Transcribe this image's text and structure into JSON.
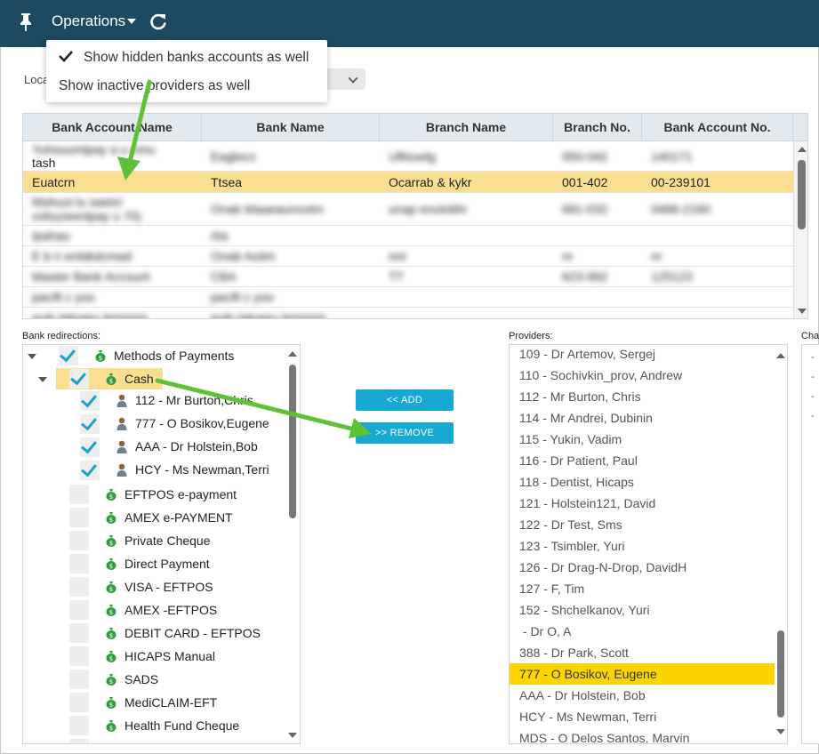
{
  "toolbar": {
    "menu_label": "Operations",
    "icons": {
      "pin": "pin-icon",
      "caret": "caret-down-icon",
      "refresh": "refresh-icon"
    }
  },
  "operations_menu": {
    "items": [
      {
        "label": "Show hidden banks accounts as well",
        "checked": true
      },
      {
        "label": "Show inactive providers as well",
        "checked": false
      }
    ]
  },
  "location": {
    "label": "Loca"
  },
  "bank_table": {
    "columns": [
      "Bank Account Name",
      "Bank Name",
      "Branch Name",
      "Branch No.",
      "Bank Account No."
    ],
    "rows": [
      {
        "cells": [
          "Yuhsuumlpay a u mnu",
          "Eagleco",
          "Ufkluwlg",
          "050-042",
          "140171"
        ],
        "line2": "tash",
        "blurred": true
      },
      {
        "cells": [
          "Euatcrn",
          "Ttsea",
          "Ocarrab & kykr",
          "001-402",
          "00-239101"
        ],
        "selected": true
      },
      {
        "cells": [
          "Mahuoi lu saein/",
          "Onab Maaeaunovtm",
          "unap enulvbhr",
          "681-032",
          "0466-2160"
        ],
        "line2": "vsfoureenlpay u 70)",
        "blurred": true
      },
      {
        "cells": [
          "Ipahao",
          "rtia",
          "",
          "",
          ""
        ],
        "blurred": true
      },
      {
        "cells": [
          "E b n enlakdcmad",
          "Onab Aoiim",
          "nnt",
          "nr",
          "nr"
        ],
        "blurred": true
      },
      {
        "cells": [
          "Master Bank Account",
          "CBA",
          "TT",
          "623-992",
          "125123"
        ],
        "blurred": true
      },
      {
        "cells": [
          "pacift c yoo",
          "pacift c yoo",
          "",
          "",
          ""
        ],
        "blurred": true
      },
      {
        "cells": [
          "euln latnaeu lennnnn",
          "euln latnaeu lennnnn",
          "",
          "",
          ""
        ],
        "blurred": true
      }
    ]
  },
  "bank_redirections": {
    "label": "Bank redirections:",
    "root": "Methods of Payments",
    "cash": "Cash",
    "cash_children": [
      "112 - Mr Burton,Chris",
      "777 - O Bosikov,Eugene",
      "AAA - Dr Holstein,Bob",
      "HCY - Ms Newman,Terri"
    ],
    "methods": [
      "EFTPOS e-payment",
      "AMEX e-PAYMENT",
      "Private Cheque",
      "Direct Payment",
      "VISA - EFTPOS",
      "AMEX -EFTPOS",
      "DEBIT CARD - EFTPOS",
      "HICAPS Manual",
      "SADS",
      "MediCLAIM-EFT",
      "Health Fund Cheque"
    ]
  },
  "buttons": {
    "add": "<< ADD",
    "remove": ">> REMOVE"
  },
  "providers": {
    "label": "Providers:",
    "items": [
      "109 - Dr Artemov, Sergej",
      "110 -  Sochivkin_prov, Andrew",
      "112 - Mr Burton, Chris",
      "114 - Mr Andrei, Dubinin",
      "115 -  Yukin, Vadim",
      "116 - Dr Patient, Paul",
      "118 -  Dentist, Hicaps",
      "121 -  Holstein121, David",
      "122 - Dr Test, Sms",
      "123 -  Tsimbler, Yuri",
      "126 - Dr Drag-N-Drop, DavidH",
      "127 -  F, Tim",
      "152 -  Shchelkanov, Yuri",
      " - Dr O, A",
      "388 - Dr Park, Scott",
      "777 - O Bosikov, Eugene",
      "AAA - Dr Holstein, Bob",
      "HCY - Ms Newman, Terri",
      "MDS - O Delos Santos, Marvin"
    ],
    "selected_index": 15
  },
  "third_panel": {
    "label": "Cha",
    "dashes": [
      "-",
      "-",
      "-",
      "-"
    ]
  },
  "colors": {
    "topbar": "#1e4a61",
    "selected_row": "#f9df8f",
    "selected_provider": "#fcd500",
    "button": "#17a9d1",
    "check": "#1aa3c9",
    "arrow": "#5fc03a",
    "bag": "#2e9e3f"
  }
}
